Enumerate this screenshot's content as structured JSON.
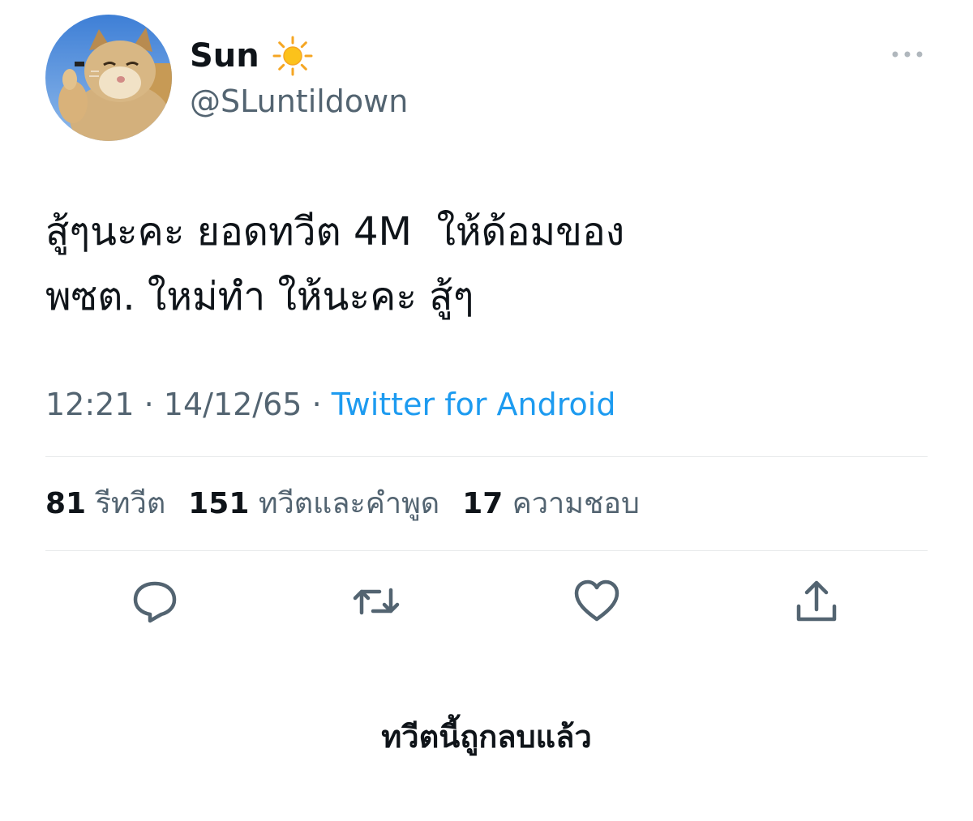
{
  "user": {
    "display_name": "Sun",
    "name_emoji": "sun-emoji",
    "handle": "@SLuntildown",
    "avatar": "cat-thumbs-up-avatar"
  },
  "tweet": {
    "text_line1": "สู้ๆนะคะ ยอดทวีต 4M  ให้ด้อมของ",
    "text_line2": "พซต. ใหม่ทำ ให้นะคะ สู้ๆ",
    "time": "12:21",
    "separator": "·",
    "date": "14/12/65",
    "source": "Twitter for Android"
  },
  "stats": {
    "retweets": "81",
    "retweets_label": "รีทวีต",
    "quotes": "151",
    "quotes_label": "ทวีตและคำพูด",
    "likes": "17",
    "likes_label": "ความชอบ"
  },
  "actions": [
    "reply-icon",
    "retweet-icon",
    "like-icon",
    "share-icon"
  ],
  "footer": {
    "deleted_notice": "ทวีตนี้ถูกลบแล้ว"
  },
  "colors": {
    "text_primary": "#0f1419",
    "text_secondary": "#536471",
    "link": "#1d9bf0",
    "divider": "#e7e9ea"
  }
}
